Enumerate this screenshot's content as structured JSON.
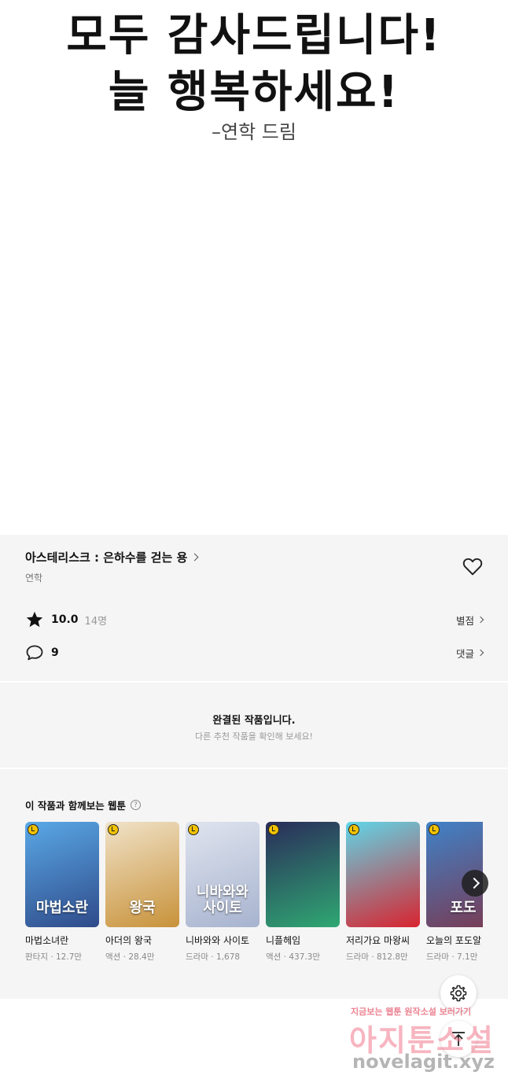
{
  "hero": {
    "line1": "모두 감사드립니다!",
    "line2": "늘 행복하세요!",
    "signature": "–연학 드림"
  },
  "work": {
    "title": "아스테리스크 : 은하수를 걷는 용",
    "author": "연학",
    "favorite_icon": "heart-outline-icon",
    "rating": "10.0",
    "rating_count": "14명",
    "rating_link": "별점",
    "comment_count": "9",
    "comment_link": "댓글"
  },
  "completion": {
    "title": "완결된 작품입니다.",
    "subtitle": "다른 추천 작품을 확인해 보세요!"
  },
  "recommendations": {
    "heading": "이 작품과 함께보는 웹툰",
    "help_icon": "?",
    "items": [
      {
        "title": "마법소녀란",
        "meta": "판타지 · 12.7만",
        "cover_text": "마법소란",
        "colors": [
          "#5aa8e6",
          "#2f4b8a"
        ]
      },
      {
        "title": "아더의 왕국",
        "meta": "액션 · 28.4만",
        "cover_text": "왕국",
        "colors": [
          "#f0e2c8",
          "#c8923a"
        ]
      },
      {
        "title": "니바와와 사이토",
        "meta": "드라마 · 1,678",
        "cover_text": "니바와와 사이토",
        "colors": [
          "#dfe4ee",
          "#a7b3cf"
        ]
      },
      {
        "title": "니플헤임",
        "meta": "액션 · 437.3만",
        "cover_text": "",
        "colors": [
          "#2a2c5a",
          "#2fa872"
        ]
      },
      {
        "title": "저리가요 마왕씨",
        "meta": "드라마 · 812.8만",
        "cover_text": "",
        "colors": [
          "#5fd6e8",
          "#d8242f"
        ]
      },
      {
        "title": "오늘의 포도알",
        "meta": "드라마 · 7.1만",
        "cover_text": "포도",
        "colors": [
          "#3f82c8",
          "#7a3a52"
        ]
      }
    ]
  },
  "controls": {
    "next_icon": "chevron-right-icon",
    "settings_icon": "gear-icon",
    "scroll_top_icon": "arrow-up-icon"
  },
  "watermark": {
    "tagline": "지금보는 웹툰 원작소설 보러가기",
    "brand": "아지툰소설",
    "url": "novelagit.xyz"
  }
}
